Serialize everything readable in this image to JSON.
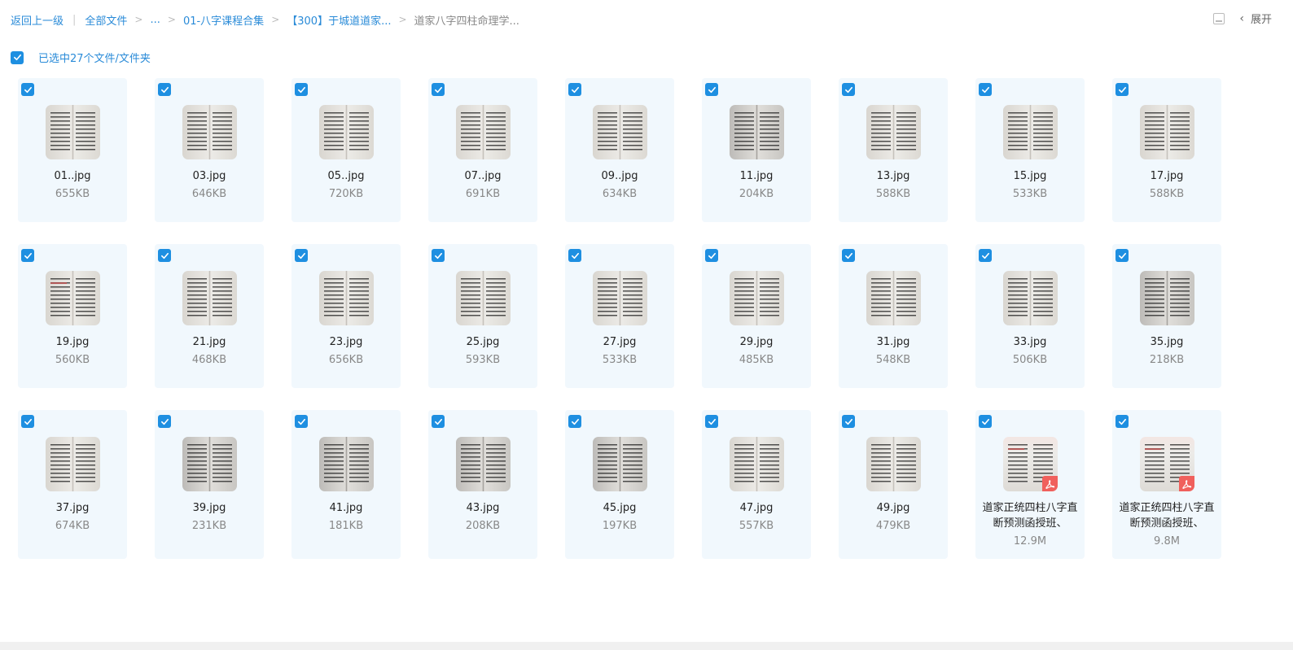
{
  "breadcrumb": {
    "back": "返回上一级",
    "all_files": "全部文件",
    "ellipsis": "...",
    "level1": "01-八字课程合集",
    "level2": "【300】于城道道家...",
    "current": "道家八字四柱命理学..."
  },
  "toolbar": {
    "expand_label": "展开"
  },
  "selection": {
    "text": "已选中27个文件/文件夹"
  },
  "files": [
    {
      "name": "01..jpg",
      "size": "655KB"
    },
    {
      "name": "03.jpg",
      "size": "646KB"
    },
    {
      "name": "05..jpg",
      "size": "720KB"
    },
    {
      "name": "07..jpg",
      "size": "691KB"
    },
    {
      "name": "09..jpg",
      "size": "634KB"
    },
    {
      "name": "11.jpg",
      "size": "204KB"
    },
    {
      "name": "13.jpg",
      "size": "588KB"
    },
    {
      "name": "15.jpg",
      "size": "533KB"
    },
    {
      "name": "17.jpg",
      "size": "588KB"
    },
    {
      "name": "19.jpg",
      "size": "560KB"
    },
    {
      "name": "21.jpg",
      "size": "468KB"
    },
    {
      "name": "23.jpg",
      "size": "656KB"
    },
    {
      "name": "25.jpg",
      "size": "593KB"
    },
    {
      "name": "27.jpg",
      "size": "533KB"
    },
    {
      "name": "29.jpg",
      "size": "485KB"
    },
    {
      "name": "31.jpg",
      "size": "548KB"
    },
    {
      "name": "33.jpg",
      "size": "506KB"
    },
    {
      "name": "35.jpg",
      "size": "218KB"
    },
    {
      "name": "37.jpg",
      "size": "674KB"
    },
    {
      "name": "39.jpg",
      "size": "231KB"
    },
    {
      "name": "41.jpg",
      "size": "181KB"
    },
    {
      "name": "43.jpg",
      "size": "208KB"
    },
    {
      "name": "45.jpg",
      "size": "197KB"
    },
    {
      "name": "47.jpg",
      "size": "557KB"
    },
    {
      "name": "49.jpg",
      "size": "479KB"
    },
    {
      "name": "道家正统四柱八字直断预测函授班、",
      "size": "12.9M",
      "type": "pdf"
    },
    {
      "name": "道家正统四柱八字直断预测函授班、",
      "size": "9.8M",
      "type": "pdf"
    }
  ],
  "colors": {
    "accent": "#1e8fe1",
    "link": "#2a8bd8",
    "card_bg": "#f1f8fd",
    "pdf": "#f0605c"
  },
  "icons": {
    "checkbox": "checkmark-icon",
    "pdf": "pdf-icon",
    "list_view": "list-view-icon",
    "expand": "chevron-left-icon"
  }
}
